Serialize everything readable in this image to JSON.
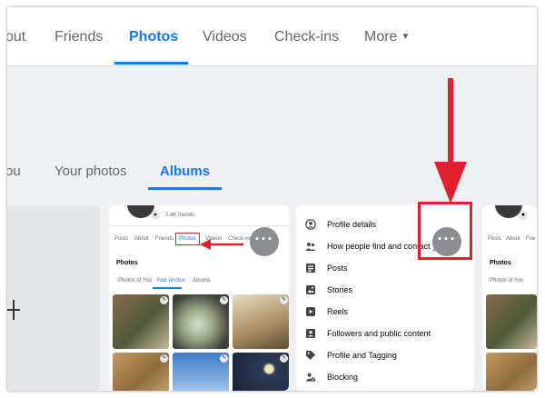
{
  "top_tabs": [
    {
      "label": "out"
    },
    {
      "label": "Friends"
    },
    {
      "label": "Photos",
      "active": true
    },
    {
      "label": "Videos"
    },
    {
      "label": "Check-ins"
    },
    {
      "label": "More"
    }
  ],
  "sub_tabs": [
    {
      "label": "ou"
    },
    {
      "label": "Your photos"
    },
    {
      "label": "Albums",
      "active": true
    }
  ],
  "screenshot_card": {
    "friends": "2.4K friends",
    "tabs": [
      "Posts",
      "About",
      "Friends",
      "Photos",
      "Videos",
      "Check-ins"
    ],
    "heading": "Photos",
    "subtabs": [
      "Photos of You",
      "Your photos",
      "Albums"
    ],
    "more_glyph": "···"
  },
  "menu": {
    "items": [
      {
        "label": "Profile details",
        "icon": "profile-circle-icon"
      },
      {
        "label": "How people find and contact you",
        "icon": "people-icon"
      },
      {
        "label": "Posts",
        "icon": "posts-icon"
      },
      {
        "label": "Stories",
        "icon": "stories-icon"
      },
      {
        "label": "Reels",
        "icon": "reels-icon"
      },
      {
        "label": "Followers and public content",
        "icon": "followers-icon"
      },
      {
        "label": "Profile and Tagging",
        "icon": "tag-icon"
      },
      {
        "label": "Blocking",
        "icon": "blocking-icon"
      }
    ],
    "more_glyph": "···"
  },
  "right_card": {
    "tabs": [
      "Posts",
      "About",
      "Frie"
    ],
    "heading": "Photos",
    "subtab": "Photos of You"
  },
  "colors": {
    "accent": "#1877f2",
    "annotation_red": "#e0202e",
    "text_secondary": "#65676b"
  }
}
